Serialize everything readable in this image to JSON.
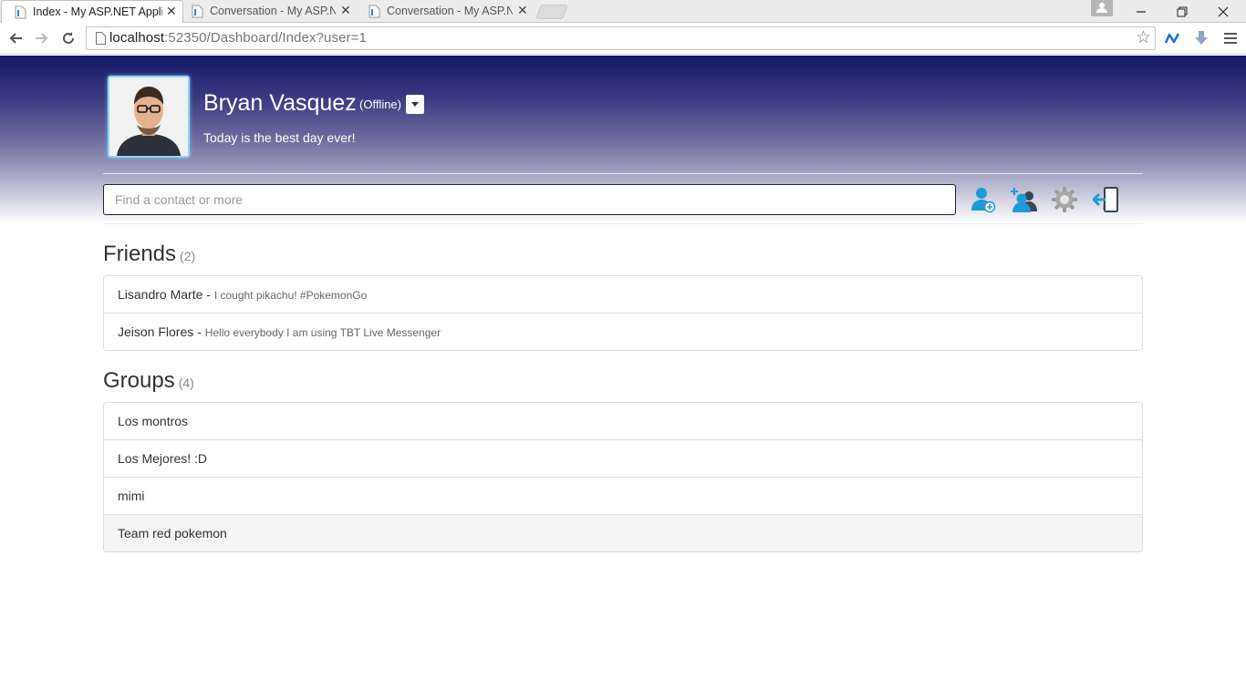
{
  "browser": {
    "tabs": [
      {
        "title": "Index - My ASP.NET Appli",
        "active": true
      },
      {
        "title": "Conversation - My ASP.NE",
        "active": false
      },
      {
        "title": "Conversation - My ASP.NE",
        "active": false
      }
    ],
    "url_host": "localhost",
    "url_rest": ":52350/Dashboard/Index?user=1"
  },
  "profile": {
    "name": "Bryan Vasquez",
    "status": "(Offline)",
    "motto": "Today is the best day ever!"
  },
  "search": {
    "placeholder": "Find a contact or more"
  },
  "actions": [
    "add-contact-icon",
    "add-group-icon",
    "settings-gear-icon",
    "logout-icon"
  ],
  "friends": {
    "title": "Friends",
    "count": "(2)",
    "items": [
      {
        "name": "Lisandro Marte",
        "separator": " - ",
        "motto": "I cought pikachu! #PokemonGo"
      },
      {
        "name": "Jeison Flores",
        "separator": " - ",
        "motto": "Hello everybody I am using TBT Live Messenger"
      }
    ]
  },
  "groups": {
    "title": "Groups",
    "count": "(4)",
    "items": [
      {
        "name": "Los montros"
      },
      {
        "name": "Los Mejores! :D"
      },
      {
        "name": "mimi"
      },
      {
        "name": "Team red pokemon"
      }
    ]
  },
  "colors": {
    "header_top": "#17176a",
    "accent_blue": "#1e9ad6",
    "chrome_bg": "#ececec"
  }
}
